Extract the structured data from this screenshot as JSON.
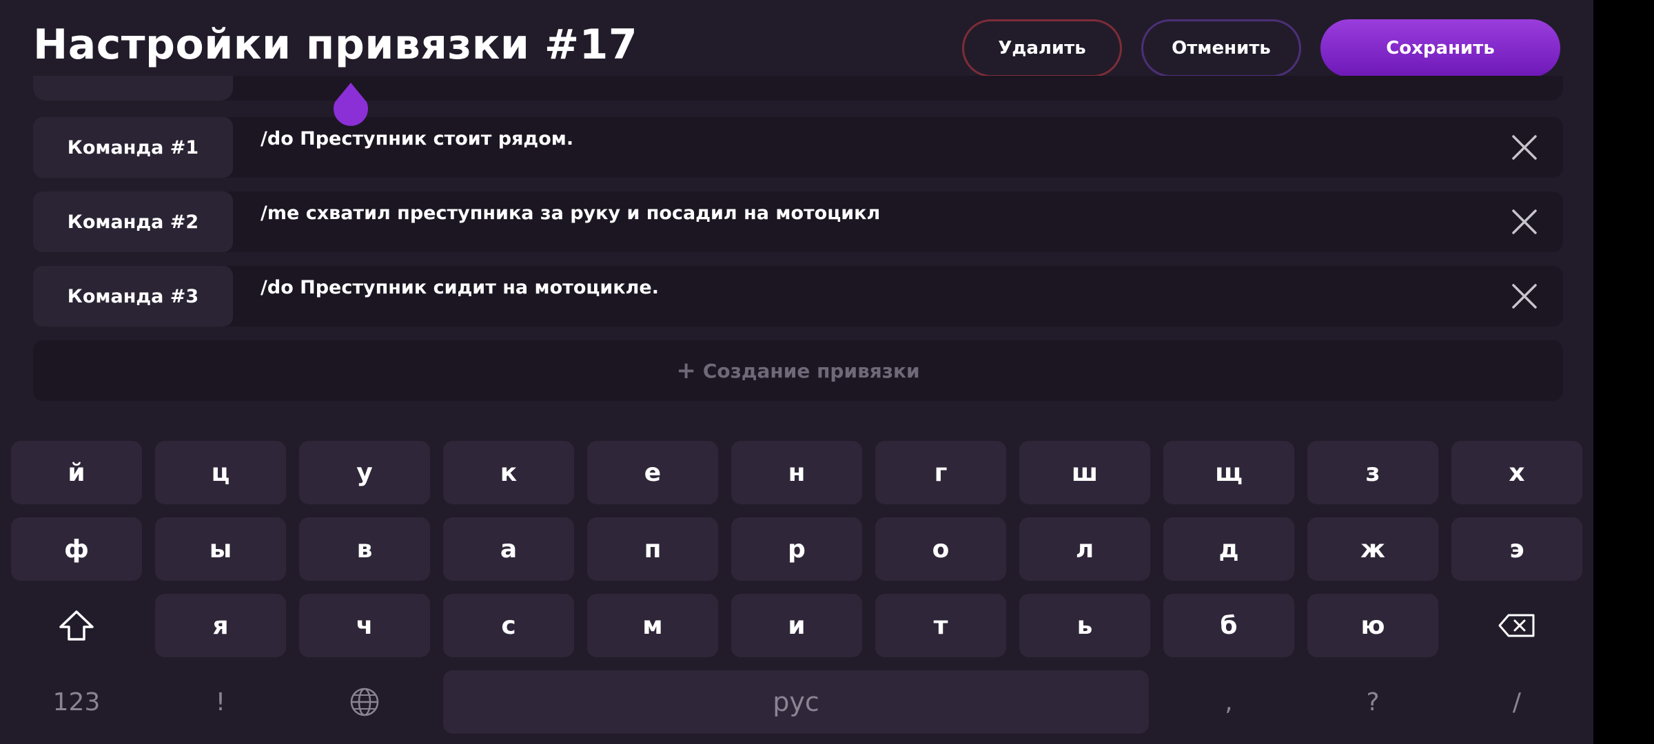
{
  "header": {
    "title": "Настройки привязки #17",
    "delete_label": "Удалить",
    "cancel_label": "Отменить",
    "save_label": "Сохранить"
  },
  "commands": [
    {
      "label": "Команда #1",
      "text": "/do Преступник стоит рядом."
    },
    {
      "label": "Команда #2",
      "text": "/me схватил преступника за руку и посадил на мотоцикл"
    },
    {
      "label": "Команда #3",
      "text": "/do Преступник сидит на мотоцикле."
    }
  ],
  "add_binding_label": "Создание привязки",
  "add_binding_icon": "plus-icon",
  "colors": {
    "accent": "#8b2fd6",
    "delete_border": "#7e2c38",
    "cancel_border": "#4d2f78",
    "background": "#221c2a",
    "key": "#2f2739"
  },
  "keyboard": {
    "row1": [
      "й",
      "ц",
      "у",
      "к",
      "е",
      "н",
      "г",
      "ш",
      "щ",
      "з",
      "х"
    ],
    "row2": [
      "ф",
      "ы",
      "в",
      "а",
      "п",
      "р",
      "о",
      "л",
      "д",
      "ж",
      "э"
    ],
    "row3": [
      "я",
      "ч",
      "с",
      "м",
      "и",
      "т",
      "ь",
      "б",
      "ю"
    ],
    "shift_icon": "shift-icon",
    "backspace_icon": "backspace-icon",
    "numbers_label": "123",
    "exclamation": "!",
    "globe_icon": "globe-icon",
    "space_label": "рус",
    "comma": ",",
    "question": "?",
    "slash": "/"
  }
}
